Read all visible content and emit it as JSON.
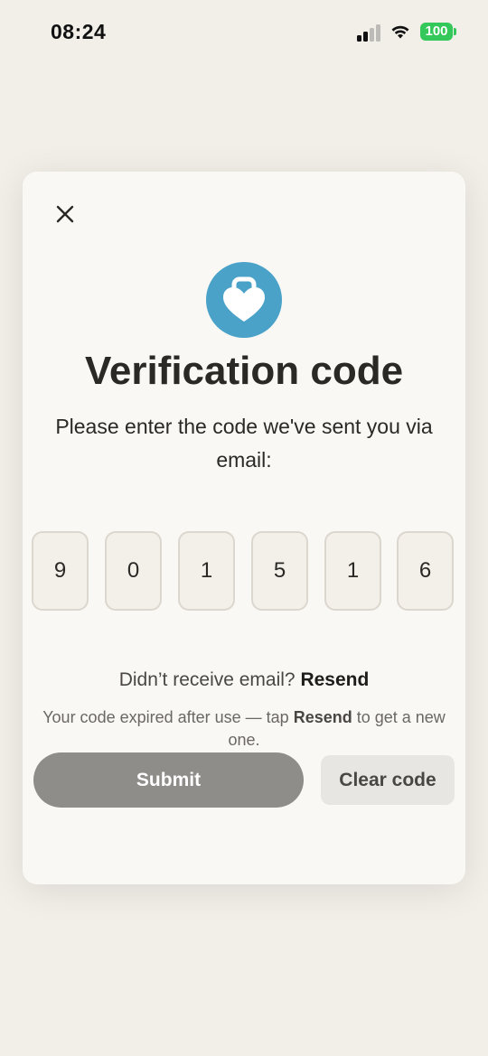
{
  "status_bar": {
    "time": "08:24",
    "battery_level": "100",
    "signal_bars_active": 2,
    "signal_bars_total": 4,
    "accent_battery": "#34c759"
  },
  "modal": {
    "close_icon": "close-icon",
    "logo_icon": "heart-lock-icon",
    "logo_color": "#4ba2c9",
    "title": "Verification code",
    "subtitle": "Please enter the code we've sent you via email:",
    "code_digits": [
      "9",
      "0",
      "1",
      "5",
      "1",
      "6"
    ],
    "resend_prompt": "Didn’t receive email?",
    "resend_link": "Resend",
    "expired_note_before": "Your code expired after use — tap ",
    "expired_note_link": "Resend",
    "expired_note_after": " to get a new one.",
    "submit_label": "Submit",
    "clear_label": "Clear code"
  }
}
